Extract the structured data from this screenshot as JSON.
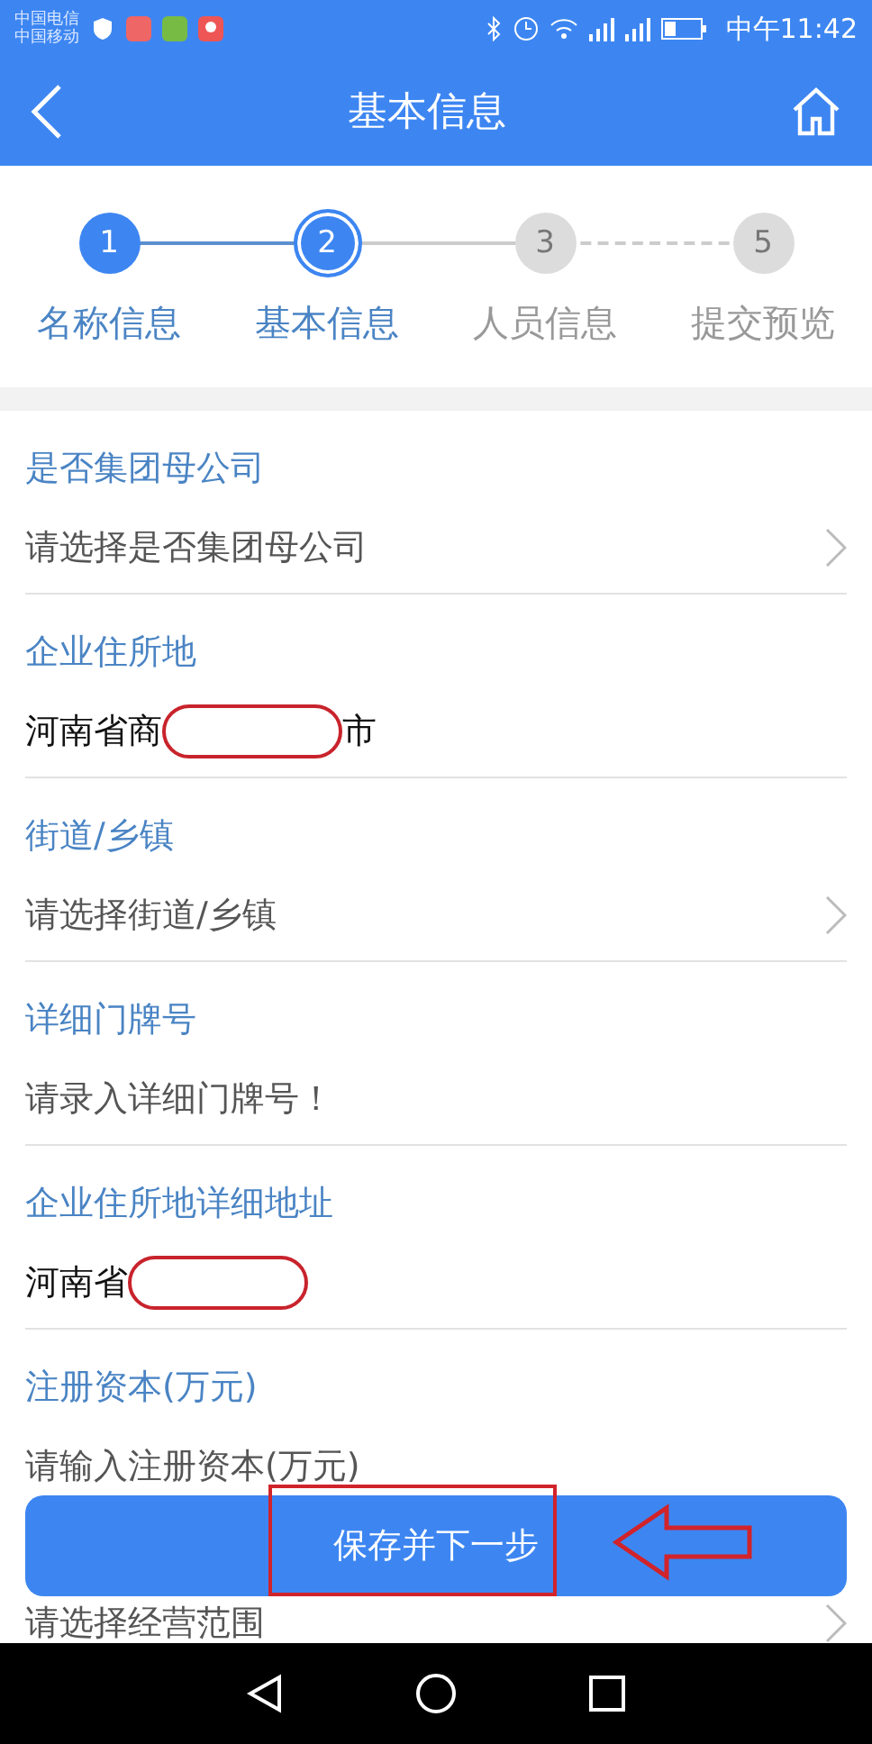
{
  "status_bar": {
    "carriers": [
      "中国电信",
      "中国移动"
    ],
    "time": "中午11:42"
  },
  "header": {
    "title": "基本信息"
  },
  "steps": [
    {
      "number": "1",
      "label": "名称信息",
      "done": true,
      "selected": false
    },
    {
      "number": "2",
      "label": "基本信息",
      "done": true,
      "selected": true
    },
    {
      "number": "3",
      "label": "人员信息",
      "done": false,
      "selected": false
    },
    {
      "number": "5",
      "label": "提交预览",
      "done": false,
      "selected": false,
      "gap_before": true
    }
  ],
  "fields": [
    {
      "label": "是否集团母公司",
      "kind": "select",
      "placeholder": "请选择是否集团母公司"
    },
    {
      "label": "企业住所地",
      "kind": "text",
      "value": "河南省商",
      "value_end": "市",
      "redacted": true
    },
    {
      "label": "街道/乡镇",
      "kind": "select",
      "placeholder": "请选择街道/乡镇"
    },
    {
      "label": "详细门牌号",
      "kind": "input",
      "placeholder": "请录入详细门牌号！"
    },
    {
      "label": "企业住所地详细地址",
      "kind": "text",
      "value": "河南省",
      "redacted": true
    },
    {
      "label": "注册资本(万元)",
      "kind": "input",
      "placeholder": "请输入注册资本(万元)"
    },
    {
      "kind": "select",
      "placeholder": "请选择经营范围"
    }
  ],
  "save_button": "保存并下一步",
  "annotations": {
    "highlight_box": true,
    "pointer_arrow": true
  }
}
